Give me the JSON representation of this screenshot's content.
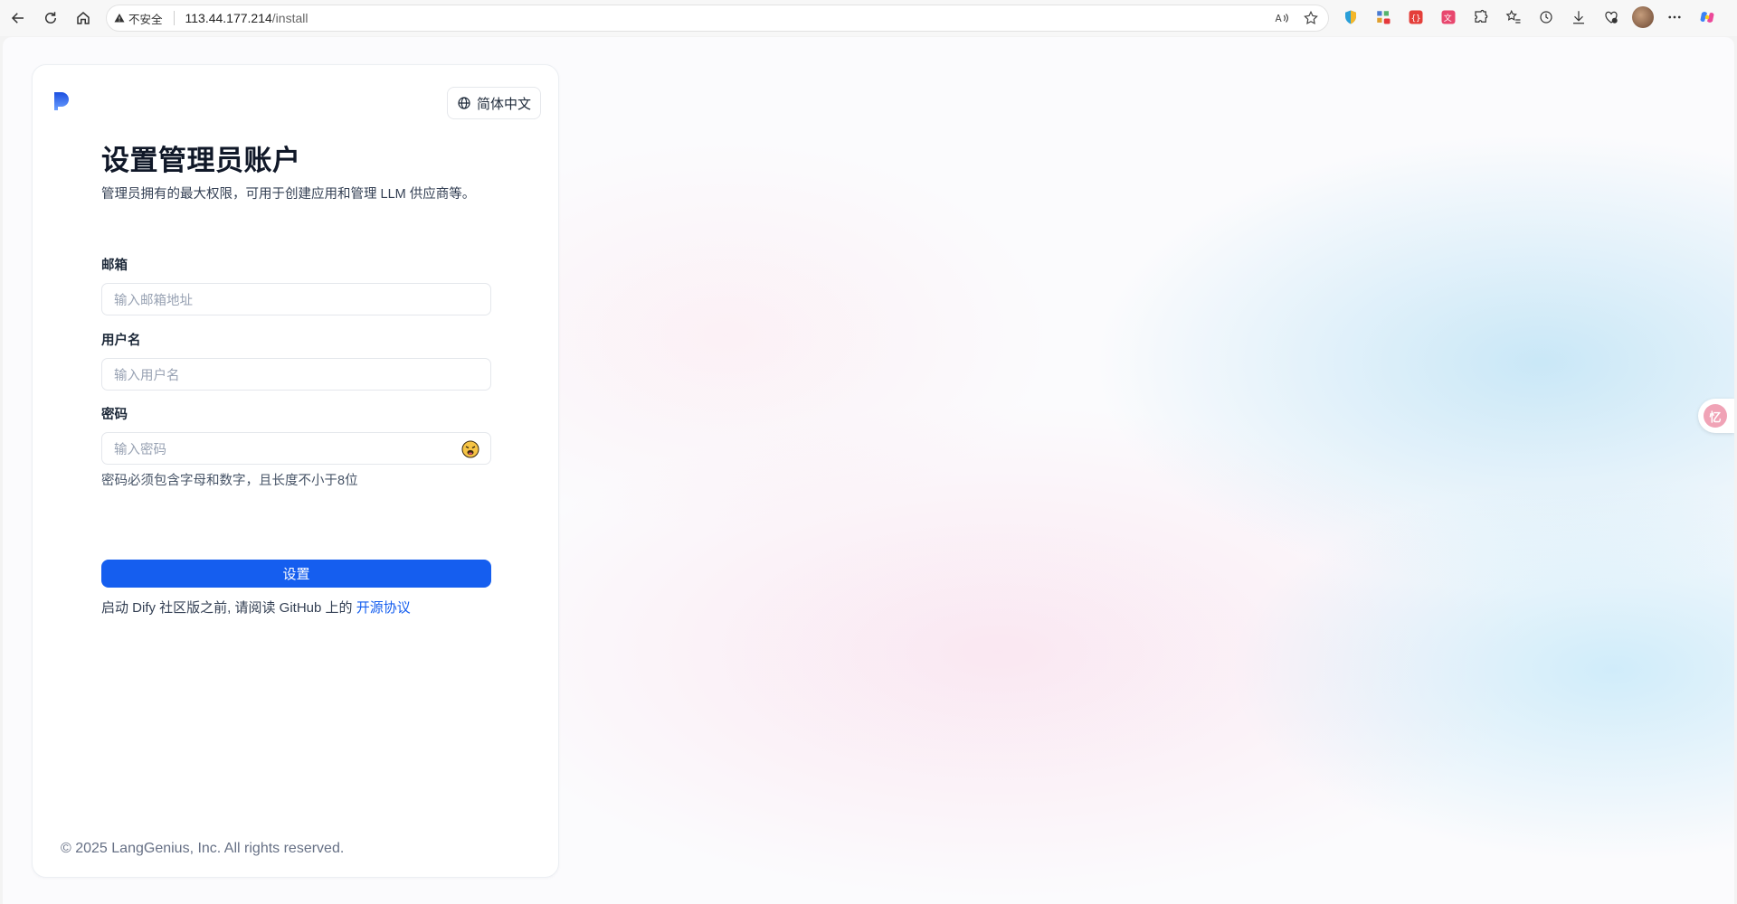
{
  "browser": {
    "security_label": "不安全",
    "url_host": "113.44.177.214",
    "url_path": "/install"
  },
  "page": {
    "language_button": "简体中文",
    "title": "设置管理员账户",
    "subtitle": "管理员拥有的最大权限，可用于创建应用和管理 LLM 供应商等。",
    "email": {
      "label": "邮箱",
      "placeholder": "输入邮箱地址",
      "value": ""
    },
    "username": {
      "label": "用户名",
      "placeholder": "输入用户名",
      "value": ""
    },
    "password": {
      "label": "密码",
      "placeholder": "输入密码",
      "value": "",
      "hint": "密码必须包含字母和数字，且长度不小于8位"
    },
    "submit_label": "设置",
    "license_prefix": "启动 Dify 社区版之前, 请阅读 GitHub 上的 ",
    "license_link": "开源协议",
    "copyright": "© 2025 LangGenius, Inc. All rights reserved."
  },
  "side_widget": {
    "label": "忆"
  },
  "colors": {
    "primary": "#155eef",
    "title": "#101828",
    "muted": "#667085"
  }
}
